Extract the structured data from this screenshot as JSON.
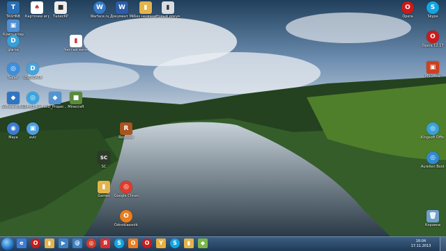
{
  "icons": [
    {
      "label": "TASHNB",
      "glyph": "T",
      "color": "#2a6fb3"
    },
    {
      "label": "Карточки игра в Дур...",
      "glyph": "♠",
      "color": "#c33"
    },
    {
      "label": "ТалисКР",
      "glyph": "■",
      "color": "#eee"
    },
    {
      "label": "Warface.ru",
      "glyph": "W",
      "color": "#3579c7"
    },
    {
      "label": "Документ Microsoft",
      "glyph": "W",
      "color": "#2b5ca8"
    },
    {
      "label": "Без названия",
      "glyph": "▮",
      "color": "#e3b44c"
    },
    {
      "label": "Новый документ",
      "glyph": "▮",
      "color": "#ccc"
    },
    {
      "label": "Компьютер",
      "glyph": "▣",
      "color": "#4f8fd3"
    },
    {
      "label": "gta-sa",
      "glyph": "D",
      "color": "#38a0d8"
    },
    {
      "label": "Чистый ватман",
      "glyph": "▮",
      "color": "#c33"
    },
    {
      "label": "Safari",
      "glyph": "◎",
      "color": "#3a8fe0"
    },
    {
      "label": "USERDATA",
      "glyph": "D",
      "color": "#48a2d9"
    },
    {
      "label": "Software_Bundle",
      "glyph": "◆",
      "color": "#3274c2"
    },
    {
      "label": "24_03_rus",
      "glyph": "◎",
      "color": "#3aa5e0"
    },
    {
      "label": "WiD_Proper...",
      "glyph": "◆",
      "color": "#5594d1"
    },
    {
      "label": "Minecraft",
      "glyph": "■",
      "color": "#5a8b3c"
    },
    {
      "label": "Maya",
      "glyph": "◉",
      "color": "#3b7bd1"
    },
    {
      "label": "avic",
      "glyph": "▣",
      "color": "#4aa0e0"
    },
    {
      "label": "Skype",
      "glyph": "S",
      "color": "#12a6e2"
    },
    {
      "label": "Opera",
      "glyph": "O",
      "color": "#cc1a1a"
    },
    {
      "label": "Opera 12.17",
      "glyph": "O",
      "color": "#cc1a1a"
    },
    {
      "label": "MSOffice",
      "glyph": "▣",
      "color": "#d04020"
    },
    {
      "label": "Kingsoft Office",
      "glyph": "◎",
      "color": "#38a1da"
    },
    {
      "label": "Aurelien BootSpeed",
      "glyph": "◎",
      "color": "#2f8ad3"
    },
    {
      "label": "Корзина",
      "glyph": "🗑",
      "color": "#6ea0c9"
    },
    {
      "label": "SC",
      "glyph": "SC",
      "color": "#2d3a2a"
    },
    {
      "label": "Games",
      "glyph": "▮",
      "color": "#e3b44c"
    },
    {
      "label": "Rockstar",
      "glyph": "R",
      "color": "#a85420"
    },
    {
      "label": "Odnoklassniki",
      "glyph": "О",
      "color": "#ec7d1d"
    },
    {
      "label": "Google Chrome",
      "glyph": "◎",
      "color": "#e23b2a"
    }
  ],
  "taskbar": {
    "items": [
      {
        "name": "ie",
        "glyph": "e",
        "color": "#3a7bd5"
      },
      {
        "name": "opera",
        "glyph": "O",
        "color": "#cc1a1a"
      },
      {
        "name": "folder",
        "glyph": "▮",
        "color": "#e3b44c"
      },
      {
        "name": "media",
        "glyph": "▶",
        "color": "#3f82c4"
      },
      {
        "name": "mail",
        "glyph": "@",
        "color": "#3d7fc1"
      },
      {
        "name": "chrome",
        "glyph": "◎",
        "color": "#d03b2a"
      },
      {
        "name": "yandex",
        "glyph": "Я",
        "color": "#d9302c"
      },
      {
        "name": "skype",
        "glyph": "S",
        "color": "#12a6e2"
      },
      {
        "name": "odnoklassniki",
        "glyph": "О",
        "color": "#ec7d1d"
      },
      {
        "name": "opera2",
        "glyph": "O",
        "color": "#cc1a1a"
      },
      {
        "name": "yandex-browser",
        "glyph": "Y",
        "color": "#e9b13a"
      },
      {
        "name": "skype2",
        "glyph": "S",
        "color": "#12a6e2"
      },
      {
        "name": "explorer",
        "glyph": "▮",
        "color": "#e3b44c"
      },
      {
        "name": "app",
        "glyph": "◆",
        "color": "#7ab648"
      }
    ],
    "clock_time": "16:04",
    "clock_date": "17.11.2013"
  }
}
